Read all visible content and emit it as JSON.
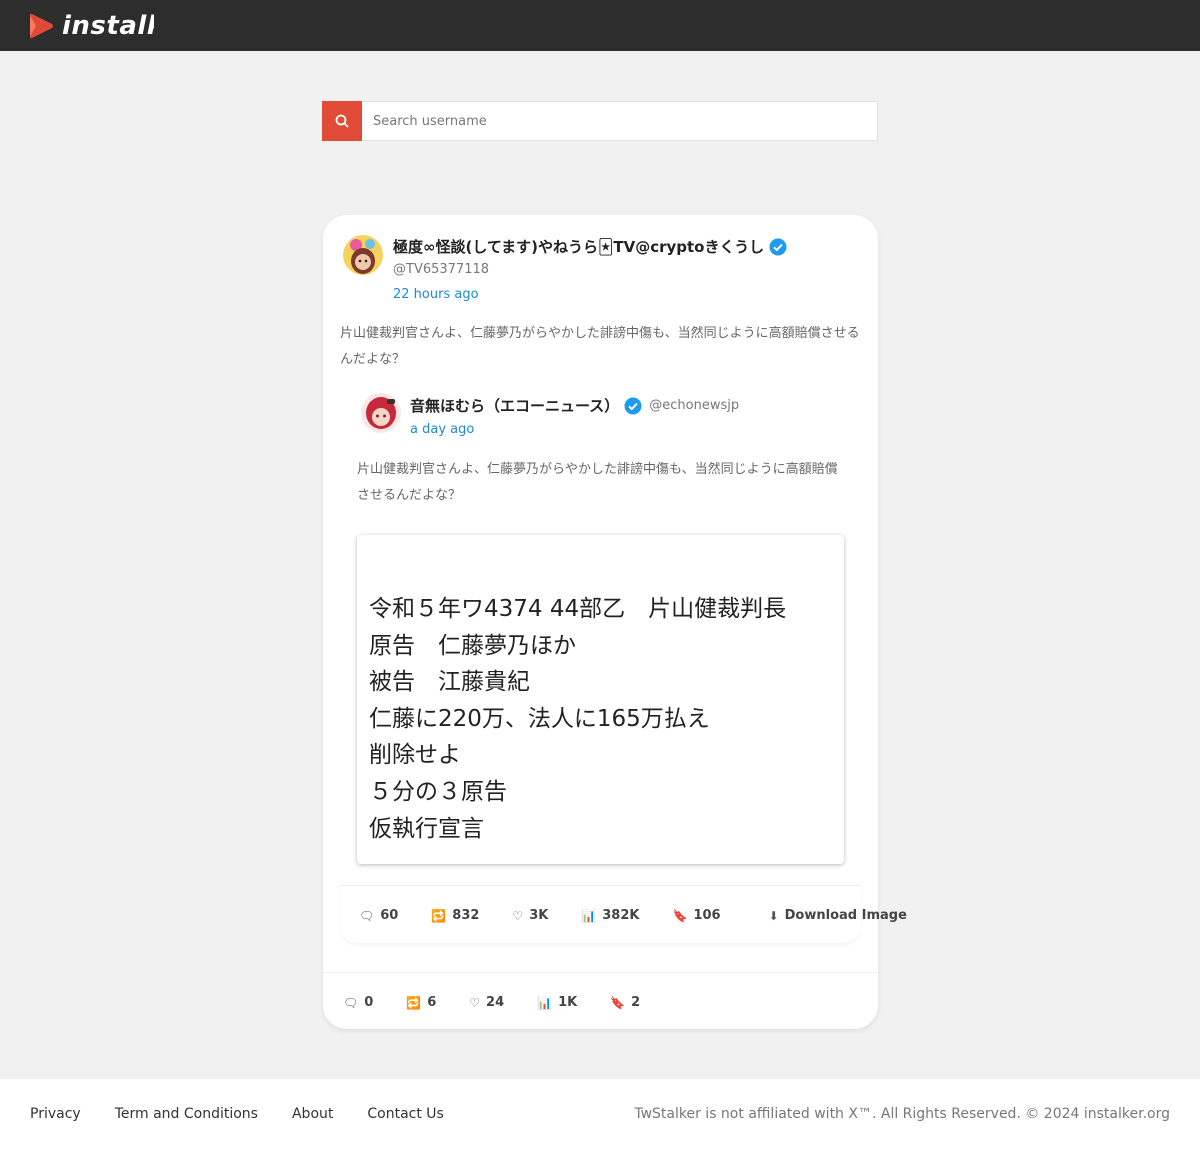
{
  "header": {
    "logo_text": "instalker",
    "brand_color": "#e04a36"
  },
  "search": {
    "icon": "search-icon",
    "placeholder": "Search username"
  },
  "post": {
    "author_name": "極度∞怪談(してます)やねうら🃏TV@cryptoきくうし",
    "author_handle": "@TV65377118",
    "time": "22 hours ago",
    "text": "片山健裁判官さんよ、仁藤夢乃がらやかした誹謗中傷も、当然同じように高額賠償させるんだよな？",
    "quoted": {
      "author_name": "音無ほむら（エコーニュース）",
      "author_handle": "@echonewsjp",
      "time": "a day ago",
      "text": "片山健裁判官さんよ、仁藤夢乃がらやかした誹謗中傷も、当然同じように高額賠償させるんだよな？",
      "image_lines": [
        "令和５年ワ4374 44部乙　片山健裁判長",
        "原告　仁藤夢乃ほか",
        "被告　江藤貴紀",
        "仁藤に220万、法人に165万払え",
        "削除せよ",
        "５分の３原告",
        "仮執行宣言"
      ],
      "stats": [
        {
          "icon": "comment-icon",
          "glyph": "🗨",
          "value": "60"
        },
        {
          "icon": "retweet-icon",
          "glyph": "🔁",
          "value": "832"
        },
        {
          "icon": "heart-icon",
          "glyph": "♡",
          "value": "3K"
        },
        {
          "icon": "views-icon",
          "glyph": "📊",
          "value": "382K"
        },
        {
          "icon": "bookmark-icon",
          "glyph": "🔖",
          "value": "106"
        },
        {
          "icon": "download-icon",
          "glyph": "⬇",
          "value": "Download Image"
        }
      ]
    },
    "stats": [
      {
        "icon": "comment-icon",
        "glyph": "🗨",
        "value": "0"
      },
      {
        "icon": "retweet-icon",
        "glyph": "🔁",
        "value": "6"
      },
      {
        "icon": "heart-icon",
        "glyph": "♡",
        "value": "24"
      },
      {
        "icon": "views-icon",
        "glyph": "📊",
        "value": "1K"
      },
      {
        "icon": "bookmark-icon",
        "glyph": "🔖",
        "value": "2"
      }
    ]
  },
  "footer": {
    "links": {
      "privacy": "Privacy",
      "terms": "Term and Conditions",
      "about": "About",
      "contact": "Contact Us"
    },
    "copyright": "TwStalker is not affiliated with X™. All Rights Reserved. © 2024 instalker.org"
  }
}
